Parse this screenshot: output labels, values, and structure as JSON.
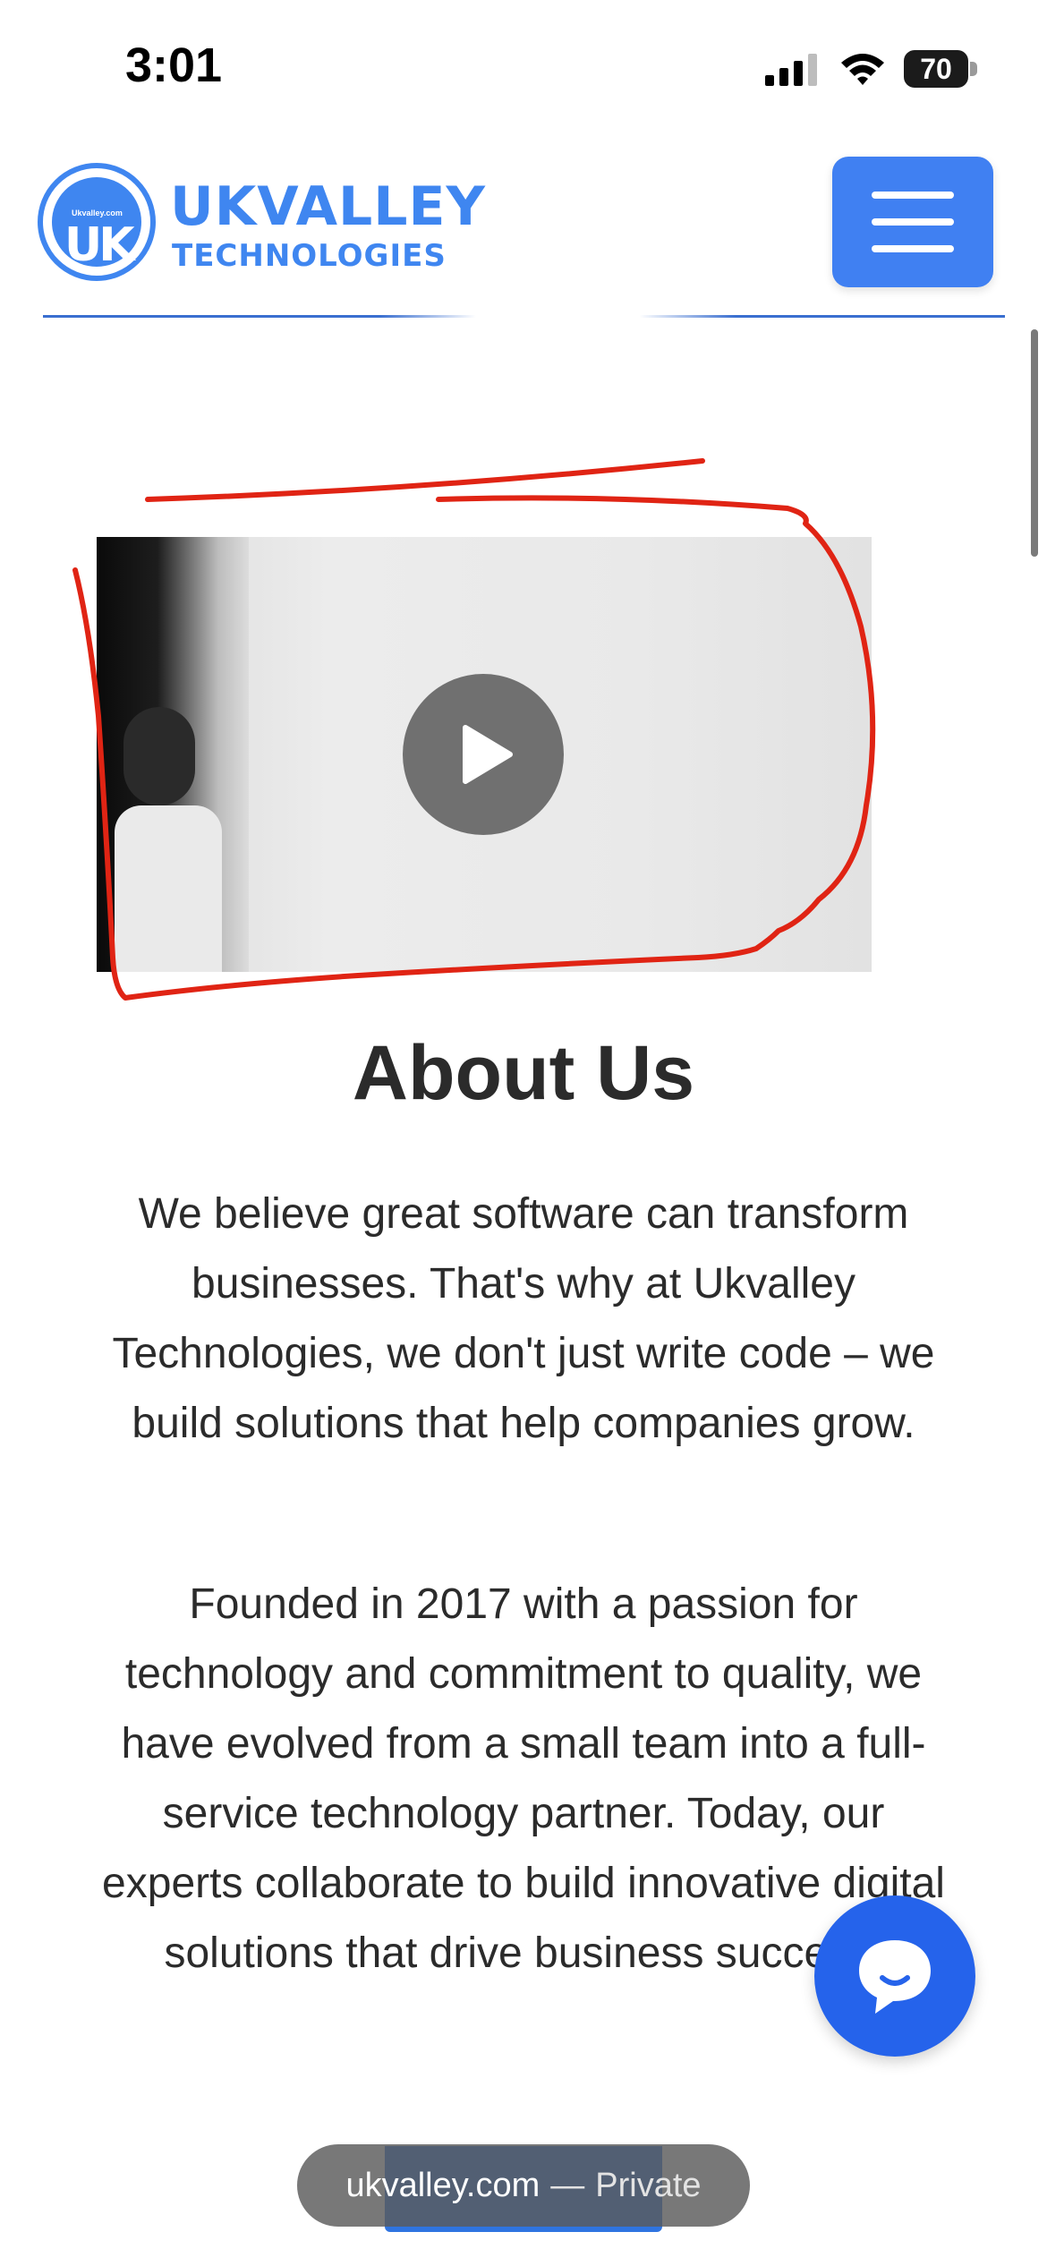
{
  "status_bar": {
    "time": "3:01",
    "battery": "70",
    "icons": [
      "signal-icon",
      "wifi-icon",
      "battery-icon"
    ]
  },
  "header": {
    "logo": {
      "mini_text": "Ukvalley.com",
      "monogram": "UK",
      "name": "UKVALLEY",
      "subtitle": "TECHNOLOGIES"
    },
    "menu_icon": "hamburger-icon"
  },
  "video": {
    "play_icon": "play-icon"
  },
  "about": {
    "title": "About Us",
    "paragraph_1": "We believe great software can transform businesses. That's why at Ukvalley Technologies, we don't just write code – we build solutions that help companies grow.",
    "paragraph_2": "Founded in 2017 with a passion for technology and commitment to quality, we have evolved from a small team into a full-service technology partner. Today, our experts collaborate to build innovative digital solutions that drive business success."
  },
  "chat": {
    "icon": "chat-bubble-icon"
  },
  "url_bar": {
    "domain": "ukvalley.com",
    "separator": "—",
    "mode": "Private"
  },
  "colors": {
    "brand_blue": "#3f86f0",
    "menu_blue": "#4080f2",
    "chat_blue": "#2563eb",
    "annotation_red": "#e02414",
    "text_dark": "#2b2b2b"
  }
}
